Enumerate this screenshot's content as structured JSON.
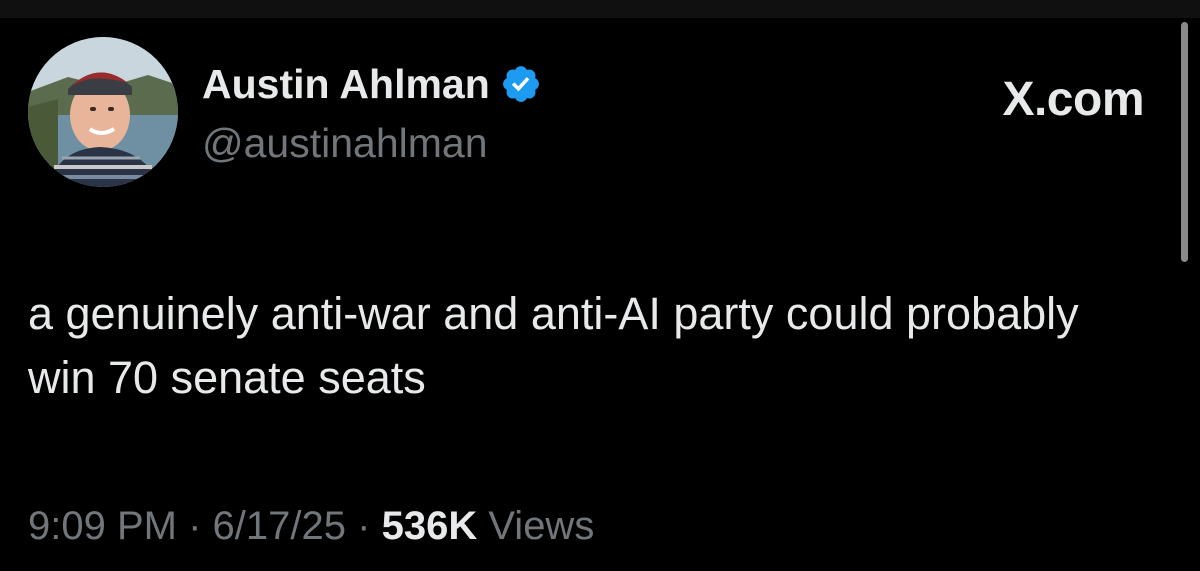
{
  "tweet": {
    "author": {
      "display_name": "Austin Ahlman",
      "handle": "@austinahlman",
      "verified": true,
      "avatar_icon": "avatar-photo",
      "verified_icon": "verified-badge-icon"
    },
    "site_label": "X.com",
    "text": "a genuinely anti-war and anti-AI party could probably win 70 senate seats",
    "time": "9:09 PM",
    "date": "6/17/25",
    "separator": "·",
    "views_count": "536K",
    "views_label": "Views"
  },
  "colors": {
    "background": "#000000",
    "primary_text": "#e7e9ea",
    "secondary_text": "#71767b",
    "verified_blue": "#1d9bf0"
  }
}
